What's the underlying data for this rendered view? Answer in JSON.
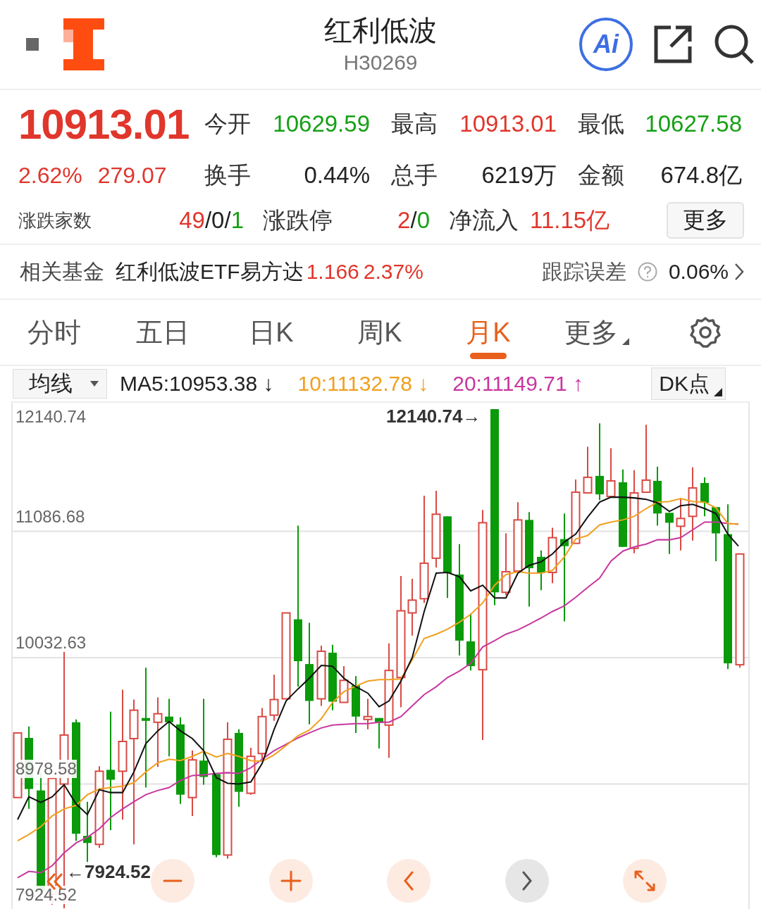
{
  "header": {
    "title": "红利低波",
    "code": "H30269",
    "ai_label": "Ai"
  },
  "quote": {
    "price": "10913.01",
    "color": "#e0362c",
    "change_pct": "2.62%",
    "change": "279.07",
    "stats": [
      {
        "label": "今开",
        "value": "10629.59",
        "color": "#16a016"
      },
      {
        "label": "最高",
        "value": "10913.01",
        "color": "#e0362c"
      },
      {
        "label": "最低",
        "value": "10627.58",
        "color": "#16a016"
      },
      {
        "label": "换手",
        "value": "0.44%",
        "color": "#222222"
      },
      {
        "label": "总手",
        "value": "6219万",
        "color": "#222222"
      },
      {
        "label": "金额",
        "value": "674.8亿",
        "color": "#222222"
      }
    ],
    "breadth": {
      "label": "涨跌家数",
      "parts": [
        {
          "text": "49",
          "color": "#e0362c"
        },
        {
          "text": "/0/",
          "color": "#222222"
        },
        {
          "text": "1",
          "color": "#16a016"
        }
      ]
    },
    "limit": {
      "label": "涨跌停",
      "parts": [
        {
          "text": "2",
          "color": "#e0362c"
        },
        {
          "text": "/",
          "color": "#222222"
        },
        {
          "text": "0",
          "color": "#16a016"
        }
      ]
    },
    "net_inflow": {
      "label": "净流入",
      "value": "11.15亿",
      "color": "#e0362c"
    },
    "more_button": "更多"
  },
  "fund": {
    "label": "相关基金",
    "name": "红利低波ETF易方达",
    "price": "1.166",
    "change": "2.37%",
    "color": "#e0362c",
    "tracking_label": "跟踪误差",
    "tracking_value": "0.06%"
  },
  "period_tabs": [
    {
      "label": "分时",
      "selected": false,
      "dropdown": false
    },
    {
      "label": "五日",
      "selected": false,
      "dropdown": false
    },
    {
      "label": "日K",
      "selected": false,
      "dropdown": false
    },
    {
      "label": "周K",
      "selected": false,
      "dropdown": false
    },
    {
      "label": "月K",
      "selected": true,
      "dropdown": false
    },
    {
      "label": "更多",
      "selected": false,
      "dropdown": true
    }
  ],
  "indicator_bar": {
    "selector": "均线",
    "ma": [
      {
        "text": "MA5:10953.38 ↓",
        "color": "#222222"
      },
      {
        "text": "10:11132.78 ↓",
        "color": "#f0a020"
      },
      {
        "text": "20:11149.71 ↑",
        "color": "#c8379e"
      }
    ],
    "dk_button": "DK点"
  },
  "chart": {
    "y_labels": [
      "12140.74",
      "11086.68",
      "10032.63",
      "8978.58",
      "7924.52"
    ],
    "high_marker": "12140.74→",
    "low_marker": "←7924.52"
  }
}
